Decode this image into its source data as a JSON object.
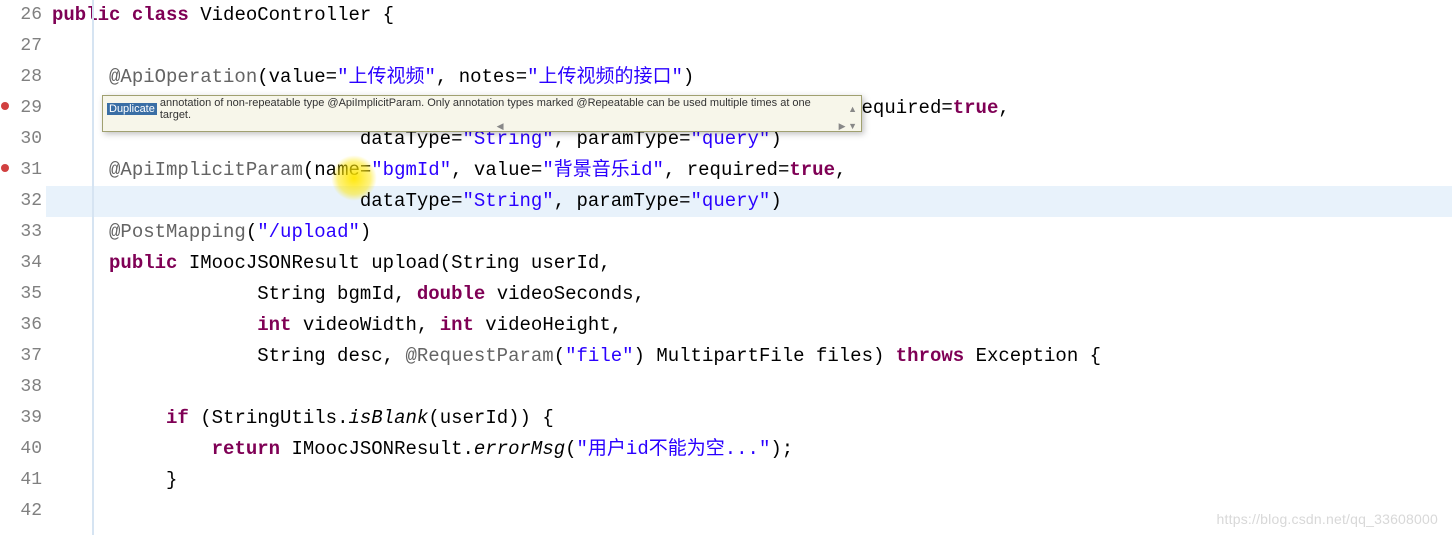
{
  "watermark": "https://blog.csdn.net/qq_33608000",
  "tooltip": {
    "highlight_word": "Duplicate",
    "message": "annotation of non-repeatable type @ApiImplicitParam. Only annotation types marked @Repeatable can be used multiple times at one target."
  },
  "gutter": {
    "start": 26,
    "end": 42
  },
  "code": {
    "l26": {
      "kw1": "public",
      "kw2": "class",
      "name": " VideoController {",
      "full_prefix": " "
    },
    "l28": {
      "ann": "@ApiOperation",
      "open": "(value=",
      "s1": "\"上传视频\"",
      "mid": ", notes=",
      "s2": "\"上传视频的接口\"",
      "close": ")"
    },
    "l29": {
      "tail_mid": ", required=",
      "tail_true": "true",
      "tail_comma": ","
    },
    "l30": {
      "indent": "                           dataType=",
      "s1": "\"String\"",
      "mid": ", paramType=",
      "s2": "\"query\"",
      "close": ")"
    },
    "l31": {
      "ann": "@ApiImplicitParam",
      "open": "(name=",
      "s1": "\"bgmId\"",
      "m1": ", value=",
      "s2": "\"背景音乐id\"",
      "m2": ", required=",
      "tr": "true",
      "comma": ","
    },
    "l32": {
      "indent": "                           dataType=",
      "s1": "\"String\"",
      "mid": ", paramType=",
      "s2": "\"query\"",
      "close": ")"
    },
    "l33": {
      "ann": "@PostMapping",
      "open": "(",
      "s1": "\"/upload\"",
      "close": ")"
    },
    "l34": {
      "kw": "public",
      "ret": " IMoocJSONResult ",
      "fn": "upload",
      "args": "(String userId,"
    },
    "l35": {
      "text": "String bgmId, ",
      "kw": "double",
      "rest": " videoSeconds,"
    },
    "l36": {
      "kw1": "int",
      "m1": " videoWidth, ",
      "kw2": "int",
      "m2": " videoHeight,"
    },
    "l37": {
      "t1": "String desc, ",
      "ann": "@RequestParam",
      "open": "(",
      "s1": "\"file\"",
      "m1": ") MultipartFile files) ",
      "kw": "throws",
      "rest": " Exception {"
    },
    "l39": {
      "kw": "if",
      "open": " (StringUtils.",
      "fn": "isBlank",
      "args": "(userId)) {"
    },
    "l40": {
      "kw": "return",
      "cls": " IMoocJSONResult.",
      "fn": "errorMsg",
      "open": "(",
      "s1": "\"用户id不能为空...\"",
      "close": ");"
    },
    "l41": {
      "text": "}"
    }
  }
}
